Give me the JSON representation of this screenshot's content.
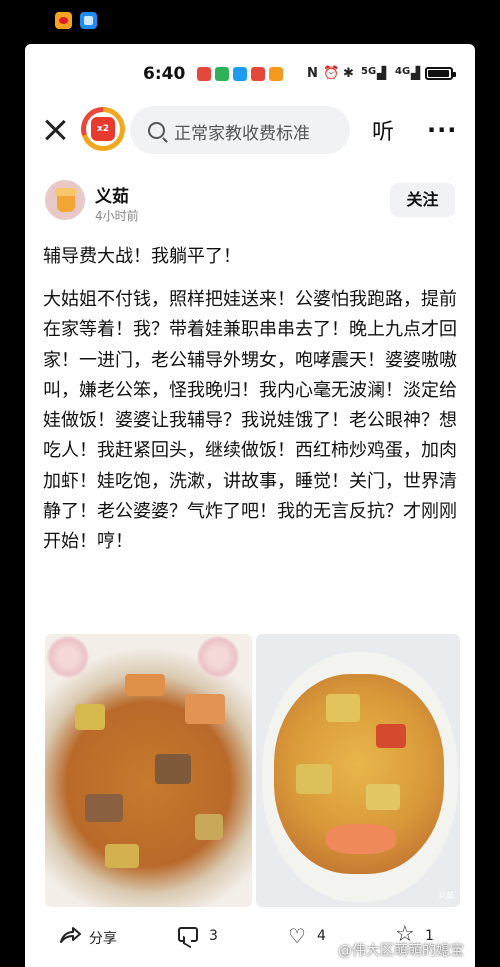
{
  "status_bar": {
    "time": "6:40",
    "network_1": "5G",
    "network_2": "4G",
    "app_icon_colors": [
      "#e5483a",
      "#2fb15a",
      "#1e9df0",
      "#e5483a",
      "#f39a1e"
    ]
  },
  "header": {
    "search_placeholder": "正常家教收费标准",
    "listen_label": "听",
    "more_label": "···",
    "logo_badge": "x2"
  },
  "author": {
    "name": "义茹",
    "time": "4小时前",
    "follow_label": "关注"
  },
  "post": {
    "title": "辅导费大战！我躺平了！",
    "body": "大姑姐不付钱，照样把娃送来！公婆怕我跑路，提前在家等着！我？带着娃兼职串串去了！晚上九点才回家！一进门，老公辅导外甥女，咆哮震天！婆婆嗷嗷叫，嫌老公笨，怪我晚归！我内心毫无波澜！淡定给娃做饭！婆婆让我辅导？我说娃饿了！老公眼神？想吃人！我赶紧回头，继续做饭！西红柿炒鸡蛋，加肉加虾！娃吃饱，洗漱，讲故事，睡觉！关门，世界清静了！老公婆婆？气炸了吧！我的无言反抗？才刚刚开始！哼！",
    "photo_watermark": "义茹"
  },
  "actions": {
    "share_label": "分享",
    "comment_count": "3",
    "like_count": "4",
    "favorite_count": "1"
  },
  "page_watermark": "@伟大区萌萌的媳宝"
}
